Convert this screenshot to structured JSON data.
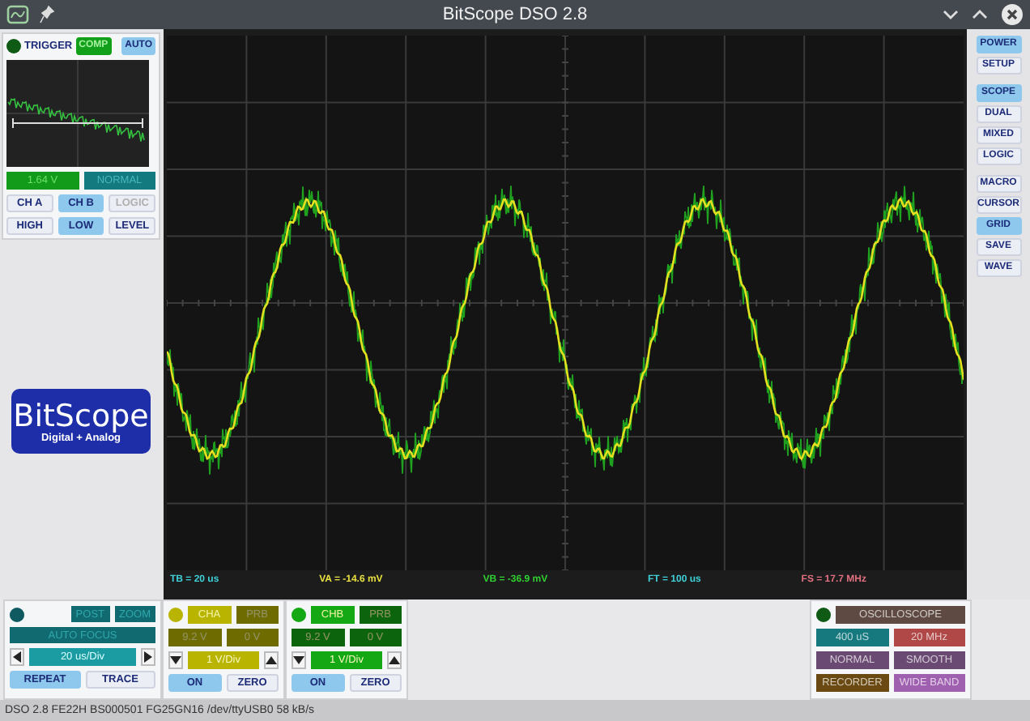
{
  "window": {
    "title": "BitScope DSO 2.8"
  },
  "trigger": {
    "label": "TRIGGER",
    "buttons": [
      {
        "label": "COMP",
        "selected": true
      },
      {
        "label": "AUTO",
        "selected": true
      }
    ],
    "level": "1.64 V",
    "mode": "NORMAL",
    "sources": [
      {
        "label": "CH A",
        "selected": false,
        "disabled": false
      },
      {
        "label": "CH B",
        "selected": true,
        "disabled": false
      },
      {
        "label": "LOGIC",
        "selected": false,
        "disabled": true
      }
    ],
    "edges": [
      {
        "label": "HIGH",
        "selected": false
      },
      {
        "label": "LOW",
        "selected": true
      },
      {
        "label": "LEVEL",
        "selected": false
      }
    ]
  },
  "logo": {
    "name": "BitScope",
    "tagline": "Digital + Analog"
  },
  "side_menu": [
    [
      {
        "label": "POWER",
        "selected": true
      },
      {
        "label": "SETUP",
        "selected": false
      }
    ],
    [
      {
        "label": "SCOPE",
        "selected": true
      },
      {
        "label": "DUAL",
        "selected": false
      },
      {
        "label": "MIXED",
        "selected": false
      },
      {
        "label": "LOGIC",
        "selected": false
      }
    ],
    [
      {
        "label": "MACRO",
        "selected": false
      },
      {
        "label": "CURSOR",
        "selected": false
      },
      {
        "label": "GRID",
        "selected": true
      },
      {
        "label": "SAVE",
        "selected": false
      },
      {
        "label": "WAVE",
        "selected": false
      }
    ]
  ],
  "readouts": [
    {
      "text": "TB = 20 us",
      "color": "#3fd0d8"
    },
    {
      "text": "VA = -14.6 mV",
      "color": "#e8e040"
    },
    {
      "text": "VB = -36.9 mV",
      "color": "#30d030"
    },
    {
      "text": "FT = 100 us",
      "color": "#3fd0d8"
    },
    {
      "text": "FS = 17.7 MHz",
      "color": "#e07080"
    }
  ],
  "timebase": {
    "post": "POST",
    "zoom": "ZOOM",
    "focus": "AUTO FOCUS",
    "rate": "20 us/Div",
    "buttons": [
      {
        "label": "REPEAT",
        "selected": true
      },
      {
        "label": "TRACE",
        "selected": false
      }
    ]
  },
  "channels": [
    {
      "name": "CHA",
      "color": "#b8b400",
      "probe": "PRB",
      "range": "9.2 V",
      "offset": "0 V",
      "scale": "1 V/Div",
      "buttons": [
        {
          "label": "ON",
          "selected": true
        },
        {
          "label": "ZERO",
          "selected": false
        }
      ]
    },
    {
      "name": "CHB",
      "color": "#14a814",
      "probe": "PRB",
      "range": "9.2 V",
      "offset": "0 V",
      "scale": "1 V/Div",
      "buttons": [
        {
          "label": "ON",
          "selected": true
        },
        {
          "label": "ZERO",
          "selected": false
        }
      ]
    }
  ],
  "mode_panel": {
    "buttons": [
      {
        "label": "OSCILLOSCOPE",
        "color": "#5e4a42"
      },
      {
        "label": "400 uS",
        "color": "#15797e"
      },
      {
        "label": "20 MHz",
        "color": "#b04848"
      },
      {
        "label": "NORMAL",
        "color": "#6a4a72"
      },
      {
        "label": "SMOOTH",
        "color": "#6a4a72"
      },
      {
        "label": "RECORDER",
        "color": "#6a4a12"
      },
      {
        "label": "WIDE BAND",
        "color": "#a060b0"
      }
    ]
  },
  "status_bar": "DSO 2.8 FE22H BS000501 FG25GN16 /dev/ttyUSB0 58 kB/s"
}
